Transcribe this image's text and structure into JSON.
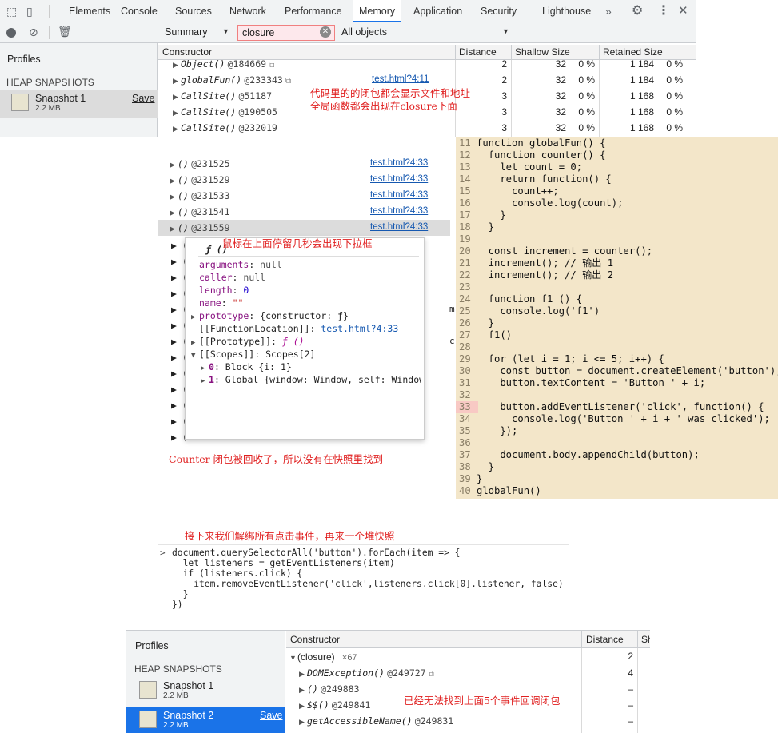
{
  "toolbar": {
    "tabs": [
      "Elements",
      "Console",
      "Sources",
      "Network",
      "Performance",
      "Memory",
      "Application",
      "Security",
      "Lighthouse"
    ],
    "more": "»",
    "close": "✕"
  },
  "filter": {
    "view": "Summary",
    "search_value": "closure",
    "scope": "All objects"
  },
  "profiles": {
    "title": "Profiles",
    "section": "HEAP SNAPSHOTS",
    "snapshot1_name": "Snapshot 1",
    "snapshot1_size": "2.2 MB",
    "save": "Save"
  },
  "table": {
    "headers": [
      "Constructor",
      "Distance",
      "Shallow Size",
      "Retained Size"
    ],
    "rows": [
      {
        "name": "Object()",
        "id": "@184669",
        "link": "",
        "distance": "2",
        "shallow": "32",
        "sp": "0 %",
        "retained": "1 184",
        "rp": "0 %"
      },
      {
        "name": "globalFun()",
        "id": "@233343",
        "link": "test.html?4:11",
        "distance": "2",
        "shallow": "32",
        "sp": "0 %",
        "retained": "1 184",
        "rp": "0 %"
      },
      {
        "name": "CallSite()",
        "id": "@51187",
        "link": "",
        "distance": "3",
        "shallow": "32",
        "sp": "0 %",
        "retained": "1 168",
        "rp": "0 %"
      },
      {
        "name": "CallSite()",
        "id": "@190505",
        "link": "",
        "distance": "3",
        "shallow": "32",
        "sp": "0 %",
        "retained": "1 168",
        "rp": "0 %"
      },
      {
        "name": "CallSite()",
        "id": "@232019",
        "link": "",
        "distance": "3",
        "shallow": "32",
        "sp": "0 %",
        "retained": "1 168",
        "rp": "0 %"
      }
    ]
  },
  "annotations": {
    "note1_line1": "代码里的的闭包都会显示文件和地址",
    "note1_line2": "全局函数都会出现在closure下面",
    "note2": "鼠标在上面停留几秒会出现下拉框",
    "note3": "Counter 闭包被回收了，所以没有在快照里找到",
    "note4": "接下来我们解绑所有点击事件，再来一个堆快照",
    "note5": "已经无法找到上面5个事件回调闭包"
  },
  "closures": [
    {
      "name": "()",
      "id": "@231525",
      "link": "test.html?4:33"
    },
    {
      "name": "()",
      "id": "@231529",
      "link": "test.html?4:33"
    },
    {
      "name": "()",
      "id": "@231533",
      "link": "test.html?4:33"
    },
    {
      "name": "()",
      "id": "@231541",
      "link": "test.html?4:33"
    },
    {
      "name": "()",
      "id": "@231559",
      "link": "test.html?4:33"
    }
  ],
  "popover": {
    "title": "ƒ ()",
    "arguments_k": "arguments",
    "arguments_v": "null",
    "caller_k": "caller",
    "caller_v": "null",
    "length_k": "length",
    "length_v": "0",
    "name_k": "name",
    "name_v": "\"\"",
    "prototype_k": "prototype",
    "prototype_v": "{constructor: ƒ}",
    "location_k": "[[FunctionLocation]]:",
    "location_v": "test.html?4:33",
    "proto_k": "[[Prototype]]:",
    "proto_v": "ƒ ()",
    "scopes_k": "[[Scopes]]:",
    "scopes_v": "Scopes[2]",
    "scope0_k": "0",
    "scope0_v": "Block {i: 1}",
    "scope1_k": "1",
    "scope1_v": "Global {window: Window, self: Window,"
  },
  "code": [
    {
      "n": "11",
      "t": "function globalFun() {"
    },
    {
      "n": "12",
      "t": "  function counter() {"
    },
    {
      "n": "13",
      "t": "    let count = 0;"
    },
    {
      "n": "14",
      "t": "    return function() {"
    },
    {
      "n": "15",
      "t": "      count++;"
    },
    {
      "n": "16",
      "t": "      console.log(count);"
    },
    {
      "n": "17",
      "t": "    }"
    },
    {
      "n": "18",
      "t": "  }"
    },
    {
      "n": "19",
      "t": ""
    },
    {
      "n": "20",
      "t": "  const increment = counter();"
    },
    {
      "n": "21",
      "t": "  increment(); // 输出 1"
    },
    {
      "n": "22",
      "t": "  increment(); // 输出 2"
    },
    {
      "n": "23",
      "t": ""
    },
    {
      "n": "24",
      "t": "  function f1 () {"
    },
    {
      "n": "25",
      "t": "    console.log('f1')"
    },
    {
      "n": "26",
      "t": "  }"
    },
    {
      "n": "27",
      "t": "  f1()"
    },
    {
      "n": "28",
      "t": ""
    },
    {
      "n": "29",
      "t": "  for (let i = 1; i <= 5; i++) {"
    },
    {
      "n": "30",
      "t": "    const button = document.createElement('button');"
    },
    {
      "n": "31",
      "t": "    button.textContent = 'Button ' + i;"
    },
    {
      "n": "32",
      "t": ""
    },
    {
      "n": "33",
      "t": "    button.addEventListener('click', function() {"
    },
    {
      "n": "34",
      "t": "      console.log('Button ' + i + ' was clicked');"
    },
    {
      "n": "35",
      "t": "    });"
    },
    {
      "n": "36",
      "t": ""
    },
    {
      "n": "37",
      "t": "    document.body.appendChild(button);"
    },
    {
      "n": "38",
      "t": "  }"
    },
    {
      "n": "39",
      "t": "}"
    },
    {
      "n": "40",
      "t": "globalFun()"
    }
  ],
  "console_code": [
    "document.querySelectorAll('button').forEach(item => {",
    "  let listeners = getEventListeners(item)",
    "  if (listeners.click) {",
    "    item.removeEventListener('click',listeners.click[0].listener, false)",
    "  }",
    "})"
  ],
  "console_prompt": ">",
  "bottom": {
    "profiles_title": "Profiles",
    "section": "HEAP SNAPSHOTS",
    "snap1": "Snapshot 1",
    "snap1_size": "2.2 MB",
    "snap2": "Snapshot 2",
    "snap2_size": "2.2 MB",
    "save": "Save",
    "headers": [
      "Constructor",
      "Distance",
      "Sh"
    ],
    "group_name": "(closure)",
    "group_count": "×67",
    "group_distance": "2",
    "rows": [
      {
        "name": "DOMException()",
        "id": "@249727",
        "distance": "4"
      },
      {
        "name": "()",
        "id": "@249883",
        "distance": "–"
      },
      {
        "name": "$$()",
        "id": "@249841",
        "distance": "–"
      },
      {
        "name": "getAccessibleName()",
        "id": "@249831",
        "distance": "–"
      }
    ]
  },
  "colors": {
    "accent": "#1a73e8",
    "annotation": "#e02020",
    "code_bg": "#f3e6c9",
    "selected": "#dcdcdc"
  }
}
